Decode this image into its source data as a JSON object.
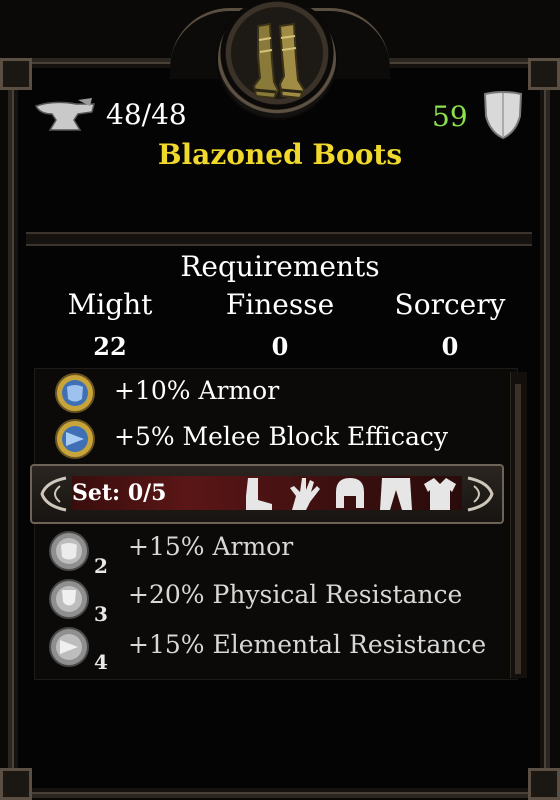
{
  "item": {
    "name": "Blazoned Boots",
    "durability": "48/48",
    "armor": "59"
  },
  "icons": {
    "item": "boots-icon",
    "durability": "anvil-icon",
    "armor": "shield-icon"
  },
  "requirements": {
    "title": "Requirements",
    "stats": [
      {
        "name": "Might",
        "value": "22"
      },
      {
        "name": "Finesse",
        "value": "0"
      },
      {
        "name": "Sorcery",
        "value": "0"
      }
    ]
  },
  "bonuses": [
    {
      "text": "+10% Armor",
      "icon": "gold-armor-gem-icon"
    },
    {
      "text": "+5% Melee Block Efficacy",
      "icon": "gold-block-gem-icon"
    }
  ],
  "set": {
    "label": "Set: 0/5",
    "pieces": [
      "boots-piece-icon",
      "gloves-piece-icon",
      "helm-piece-icon",
      "pants-piece-icon",
      "chest-piece-icon"
    ],
    "bonuses": [
      {
        "tier": "2",
        "text": "+15% Armor",
        "icon": "silver-armor-gem-icon"
      },
      {
        "tier": "3",
        "text": "+20% Physical Resistance",
        "icon": "silver-shield-gem-icon"
      },
      {
        "tier": "4",
        "text": "+15% Elemental Resistance",
        "icon": "silver-elemental-gem-icon"
      }
    ]
  },
  "colors": {
    "name": "#f0d92c",
    "armor": "#8be04e",
    "text": "#ffffff"
  }
}
